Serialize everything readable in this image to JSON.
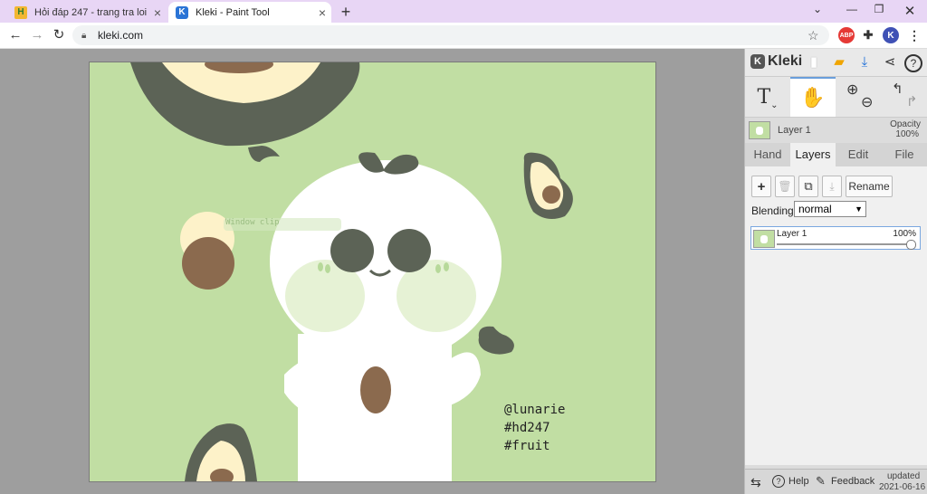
{
  "browser": {
    "tabs": [
      {
        "title": "Hỏi đáp 247 - trang tra loi",
        "favicon": "H"
      },
      {
        "title": "Kleki - Paint Tool",
        "favicon": "K"
      }
    ],
    "url": "kleki.com",
    "profile_initial": "K",
    "adblock_label": "ABP"
  },
  "canvas": {
    "signature": [
      "@lunarie",
      "#hd247",
      "#fruit"
    ],
    "watermark": "Window clip",
    "colors": {
      "bg": "#c1dea3",
      "dark": "#5c6356",
      "pit": "#8b6a4e",
      "cream": "#fdf2c9",
      "white": "#ffffff",
      "cheek": "#e6f2d5"
    }
  },
  "panel": {
    "brand": "Kleki",
    "tools": {
      "text_glyph": "T",
      "hand_glyph": "✋"
    },
    "layer_preview": {
      "name": "Layer 1",
      "opacity_label": "Opacity",
      "opacity_value": "100%"
    },
    "tabs": [
      "Hand",
      "Layers",
      "Edit",
      "File"
    ],
    "active_tab": "Layers",
    "layer_buttons": {
      "rename": "Rename"
    },
    "blending": {
      "label": "Blending",
      "value": "normal"
    },
    "layers": [
      {
        "name": "Layer 1",
        "opacity": "100%"
      }
    ],
    "footer": {
      "help": "Help",
      "feedback": "Feedback",
      "updated_label": "updated",
      "updated_date": "2021-06-16"
    }
  }
}
